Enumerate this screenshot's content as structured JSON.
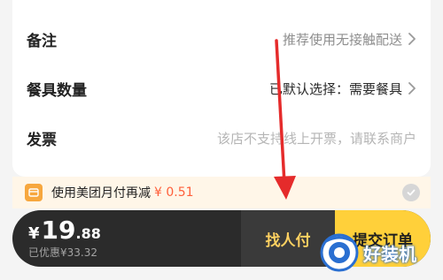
{
  "card": {
    "rows": [
      {
        "label": "备注",
        "value": "推荐使用无接触配送"
      },
      {
        "label": "餐具数量",
        "value": "已默认选择：需要餐具"
      },
      {
        "label": "发票",
        "value": "该店不支持线上开票，请联系商户"
      }
    ]
  },
  "promo": {
    "text": "使用美团月付再减",
    "amount": "¥ 0.51"
  },
  "checkout": {
    "currency": "¥",
    "price_integer": "19",
    "price_decimal": ".88",
    "saved": "已优惠¥33.32",
    "find_pay_label": "找人付",
    "submit_label": "提交订单"
  },
  "watermark": {
    "text": "好装机"
  },
  "colors": {
    "accent_yellow": "#ffd03a",
    "promo_red": "#ff5f3a",
    "annotation_red": "#e52b2b",
    "dark_bar": "#2b2b2b"
  },
  "icons": [
    "chevron-right-icon",
    "wallet-icon",
    "check-circle-icon",
    "annotation-arrow"
  ]
}
